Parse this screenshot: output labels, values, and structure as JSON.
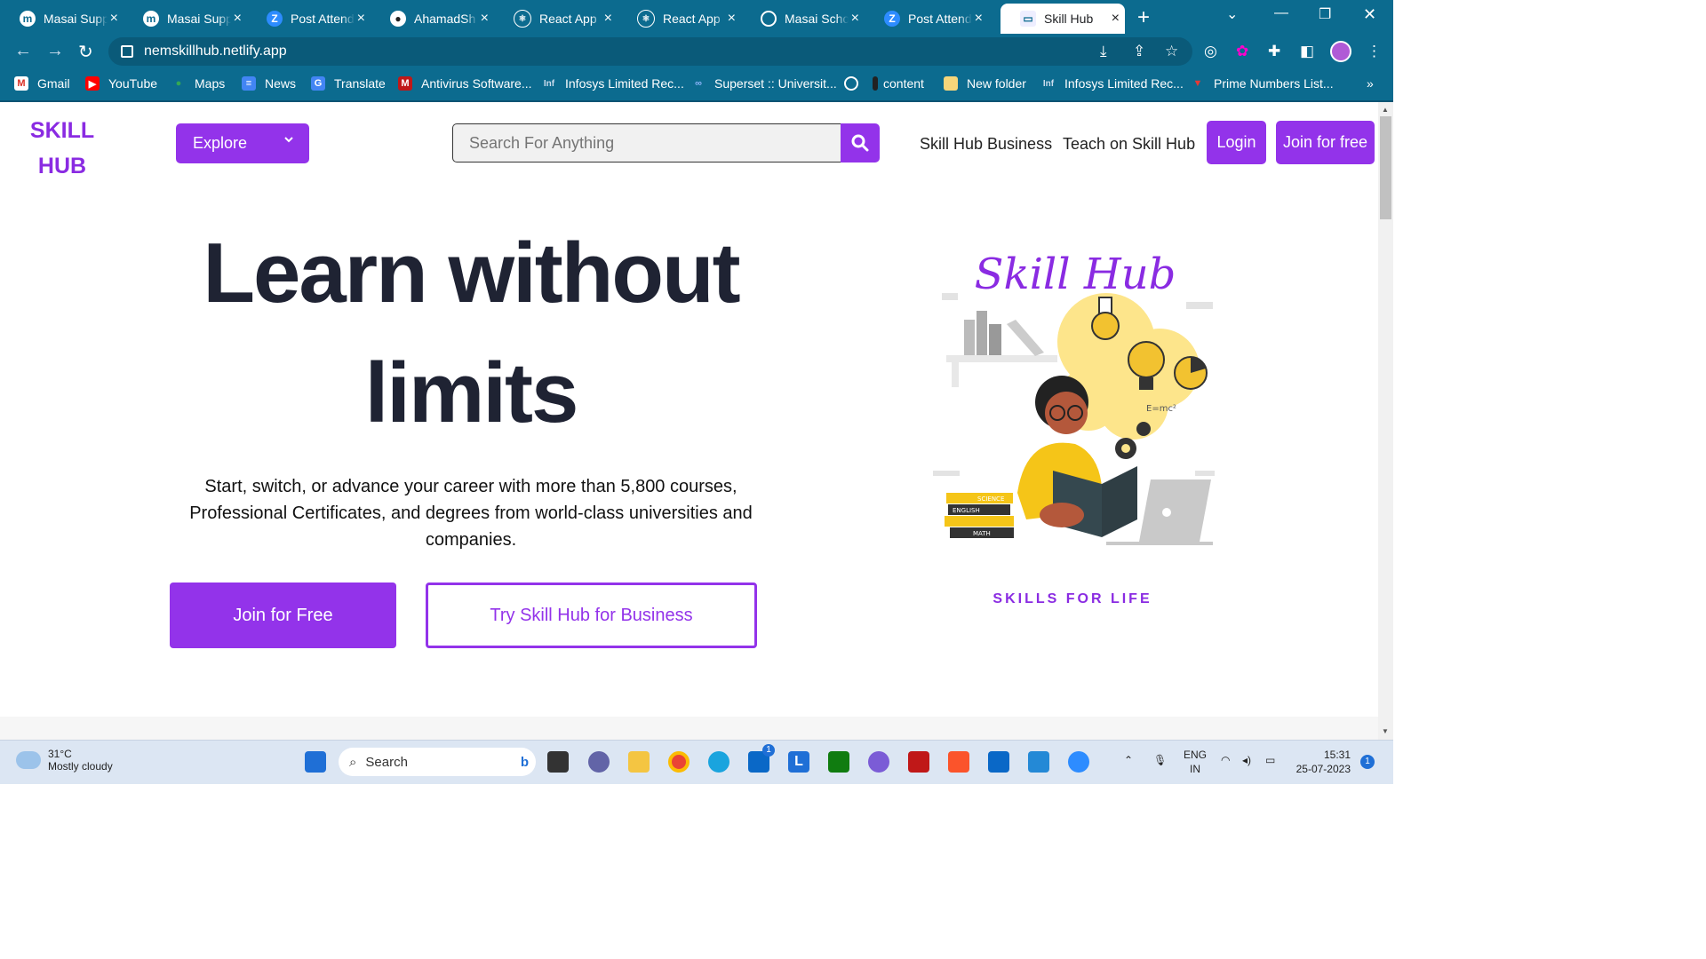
{
  "browser": {
    "tabs": [
      {
        "title": "Masai Supp",
        "icon": "m"
      },
      {
        "title": "Masai Supp",
        "icon": "m"
      },
      {
        "title": "Post Attend",
        "icon": "Z"
      },
      {
        "title": "AhamadSh",
        "icon": "gh"
      },
      {
        "title": "React App",
        "icon": "react"
      },
      {
        "title": "React App",
        "icon": "react"
      },
      {
        "title": "Masai Scho",
        "icon": "globe"
      },
      {
        "title": "Post Attend",
        "icon": "Z"
      },
      {
        "title": "Skill Hub",
        "icon": "page"
      }
    ],
    "url": "nemskillhub.netlify.app",
    "bookmarks": [
      "Gmail",
      "YouTube",
      "Maps",
      "News",
      "Translate",
      "Antivirus Software...",
      "Infosys Limited Rec...",
      "Superset :: Universit...",
      "",
      "content",
      "New folder",
      "Infosys Limited Rec...",
      "Prime Numbers List..."
    ],
    "bookmark_icon_text": {
      "infosys": "Inf"
    }
  },
  "header": {
    "logo_line1": "SKILL",
    "logo_line2": "HUB",
    "explore_label": "Explore",
    "search_placeholder": "Search For Anything",
    "business_link": "Skill Hub Business",
    "teach_link": "Teach on Skill Hub",
    "login_label": "Login",
    "join_label": "Join for free"
  },
  "hero": {
    "line1": "Learn without",
    "line2": "limits",
    "subtitle": "Start, switch, or advance your career with more than 5,800 courses, Professional Certificates, and degrees from world-class universities and companies.",
    "cta_primary": "Join for Free",
    "cta_secondary": "Try Skill Hub for Business"
  },
  "illustration": {
    "title": "Skill Hub",
    "tagline": "SKILLS FOR LIFE",
    "book_labels": [
      "SCIENCE",
      "ENGLISH",
      "MATH"
    ],
    "bubble_text": "E=mc²"
  },
  "taskbar": {
    "temperature": "31°C",
    "weather": "Mostly cloudy",
    "search_label": "Search",
    "store_badge": "1",
    "lang1": "ENG",
    "lang2": "IN",
    "time": "15:31",
    "date": "25-07-2023",
    "notification_count": "1"
  },
  "colors": {
    "brand": "#9333ea",
    "chrome": "#0c6b8f",
    "heading": "#1f2333"
  }
}
